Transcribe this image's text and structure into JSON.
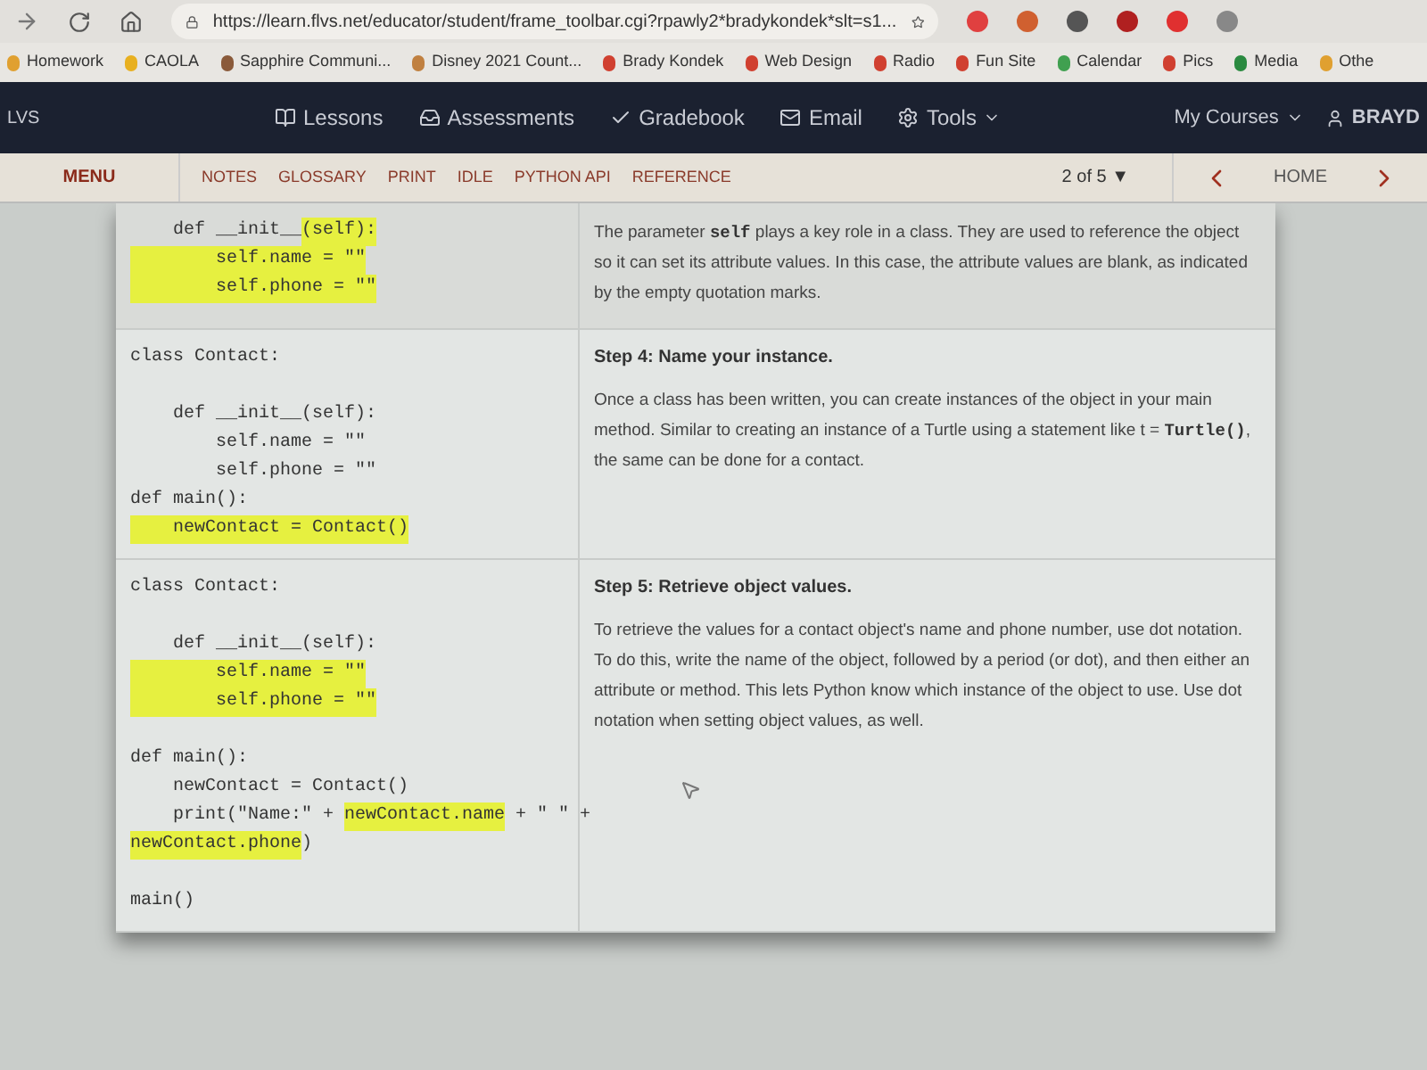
{
  "browser": {
    "url": "https://learn.flvs.net/educator/student/frame_toolbar.cgi?rpawly2*bradykondek*slt=s1...",
    "bookmarks": [
      {
        "label": "Homework",
        "color": "#e0a030"
      },
      {
        "label": "CAOLA",
        "color": "#e8b020"
      },
      {
        "label": "Sapphire Communi...",
        "color": "#8a5a3a"
      },
      {
        "label": "Disney 2021 Count...",
        "color": "#c08040"
      },
      {
        "label": "Brady Kondek",
        "color": "#d04030"
      },
      {
        "label": "Web Design",
        "color": "#d04030"
      },
      {
        "label": "Radio",
        "color": "#d04030"
      },
      {
        "label": "Fun Site",
        "color": "#d04030"
      },
      {
        "label": "Calendar",
        "color": "#40a050"
      },
      {
        "label": "Pics",
        "color": "#d04030"
      },
      {
        "label": "Media",
        "color": "#2a8a40"
      },
      {
        "label": "Othe",
        "color": "#e0a030"
      }
    ]
  },
  "nav": {
    "brand": "LVS",
    "items": [
      {
        "label": "Lessons",
        "kind": "book"
      },
      {
        "label": "Assessments",
        "kind": "tray"
      },
      {
        "label": "Gradebook",
        "kind": "check"
      },
      {
        "label": "Email",
        "kind": "mail"
      },
      {
        "label": "Tools",
        "kind": "gear"
      }
    ],
    "courses": "My Courses",
    "user": "BRAYD"
  },
  "toolbar": {
    "menu": "MENU",
    "links": [
      "NOTES",
      "GLOSSARY",
      "PRINT",
      "IDLE",
      "PYTHON API",
      "REFERENCE"
    ],
    "page": "2 of 5 ▼",
    "home": "HOME"
  },
  "rows": [
    {
      "code": [
        {
          "kind": "code",
          "segments": [
            {
              "text": "    def __init__",
              "hl": false
            },
            {
              "text": "(self):",
              "hl": true
            }
          ]
        },
        {
          "kind": "code",
          "segments": [
            {
              "text": "        self.name = \"\"",
              "hl": true
            }
          ]
        },
        {
          "kind": "code",
          "segments": [
            {
              "text": "        self.phone = \"\"",
              "hl": true
            }
          ]
        }
      ],
      "paragraph": [
        {
          "text": "The parameter ",
          "code": false
        },
        {
          "text": "self",
          "code": true
        },
        {
          "text": " plays a key role in a class. They are used to reference the object so it can set its attribute values. In this case, the attribute values are blank, as indicated by the empty quotation marks.",
          "code": false
        }
      ]
    },
    {
      "code": [
        {
          "kind": "code",
          "segments": [
            {
              "text": "class Contact:",
              "hl": false
            }
          ]
        },
        {
          "kind": "blank"
        },
        {
          "kind": "code",
          "segments": [
            {
              "text": "    def __init__(self):",
              "hl": false
            }
          ]
        },
        {
          "kind": "code",
          "segments": [
            {
              "text": "        self.name = \"\"",
              "hl": false
            }
          ]
        },
        {
          "kind": "code",
          "segments": [
            {
              "text": "        self.phone = \"\"",
              "hl": false
            }
          ]
        },
        {
          "kind": "code",
          "segments": [
            {
              "text": "def main():",
              "hl": false
            }
          ]
        },
        {
          "kind": "code",
          "segments": [
            {
              "text": "    newContact = Contact()",
              "hl": true
            }
          ]
        }
      ],
      "heading": "Step 4: Name your instance.",
      "paragraph": [
        {
          "text": "Once a class has been written, you can create instances of the object in your main method. Similar to creating an instance of a Turtle using a statement like t = ",
          "code": false
        },
        {
          "text": "Turtle()",
          "code": true
        },
        {
          "text": ", the same can be done for a contact.",
          "code": false
        }
      ]
    },
    {
      "code": [
        {
          "kind": "code",
          "segments": [
            {
              "text": "class Contact:",
              "hl": false
            }
          ]
        },
        {
          "kind": "blank"
        },
        {
          "kind": "code",
          "segments": [
            {
              "text": "    def __init__(self):",
              "hl": false
            }
          ]
        },
        {
          "kind": "code",
          "segments": [
            {
              "text": "        self.name = \"\"",
              "hl": true
            }
          ]
        },
        {
          "kind": "code",
          "segments": [
            {
              "text": "        self.phone = \"\"",
              "hl": true
            }
          ]
        },
        {
          "kind": "blank"
        },
        {
          "kind": "code",
          "segments": [
            {
              "text": "def main():",
              "hl": false
            }
          ]
        },
        {
          "kind": "code",
          "segments": [
            {
              "text": "    newContact = Contact()",
              "hl": false
            }
          ]
        },
        {
          "kind": "code",
          "segments": [
            {
              "text": "    print(\"Name:\" + ",
              "hl": false
            },
            {
              "text": "newContact.name",
              "hl": true
            },
            {
              "text": " + \" \" +",
              "hl": false
            }
          ]
        },
        {
          "kind": "code",
          "segments": [
            {
              "text": "newContact.phone",
              "hl": true
            },
            {
              "text": ")",
              "hl": false
            }
          ]
        },
        {
          "kind": "blank"
        },
        {
          "kind": "code",
          "segments": [
            {
              "text": "main()",
              "hl": false
            }
          ]
        }
      ],
      "heading": "Step 5: Retrieve object values.",
      "paragraph": [
        {
          "text": "To retrieve the values for a contact object's name and phone number, use dot notation. To do this, write the name of the object, followed by a period (or dot), and then either an attribute or method. This lets Python know which instance of the object to use. Use dot notation when setting object values, as well.",
          "code": false
        }
      ]
    }
  ]
}
